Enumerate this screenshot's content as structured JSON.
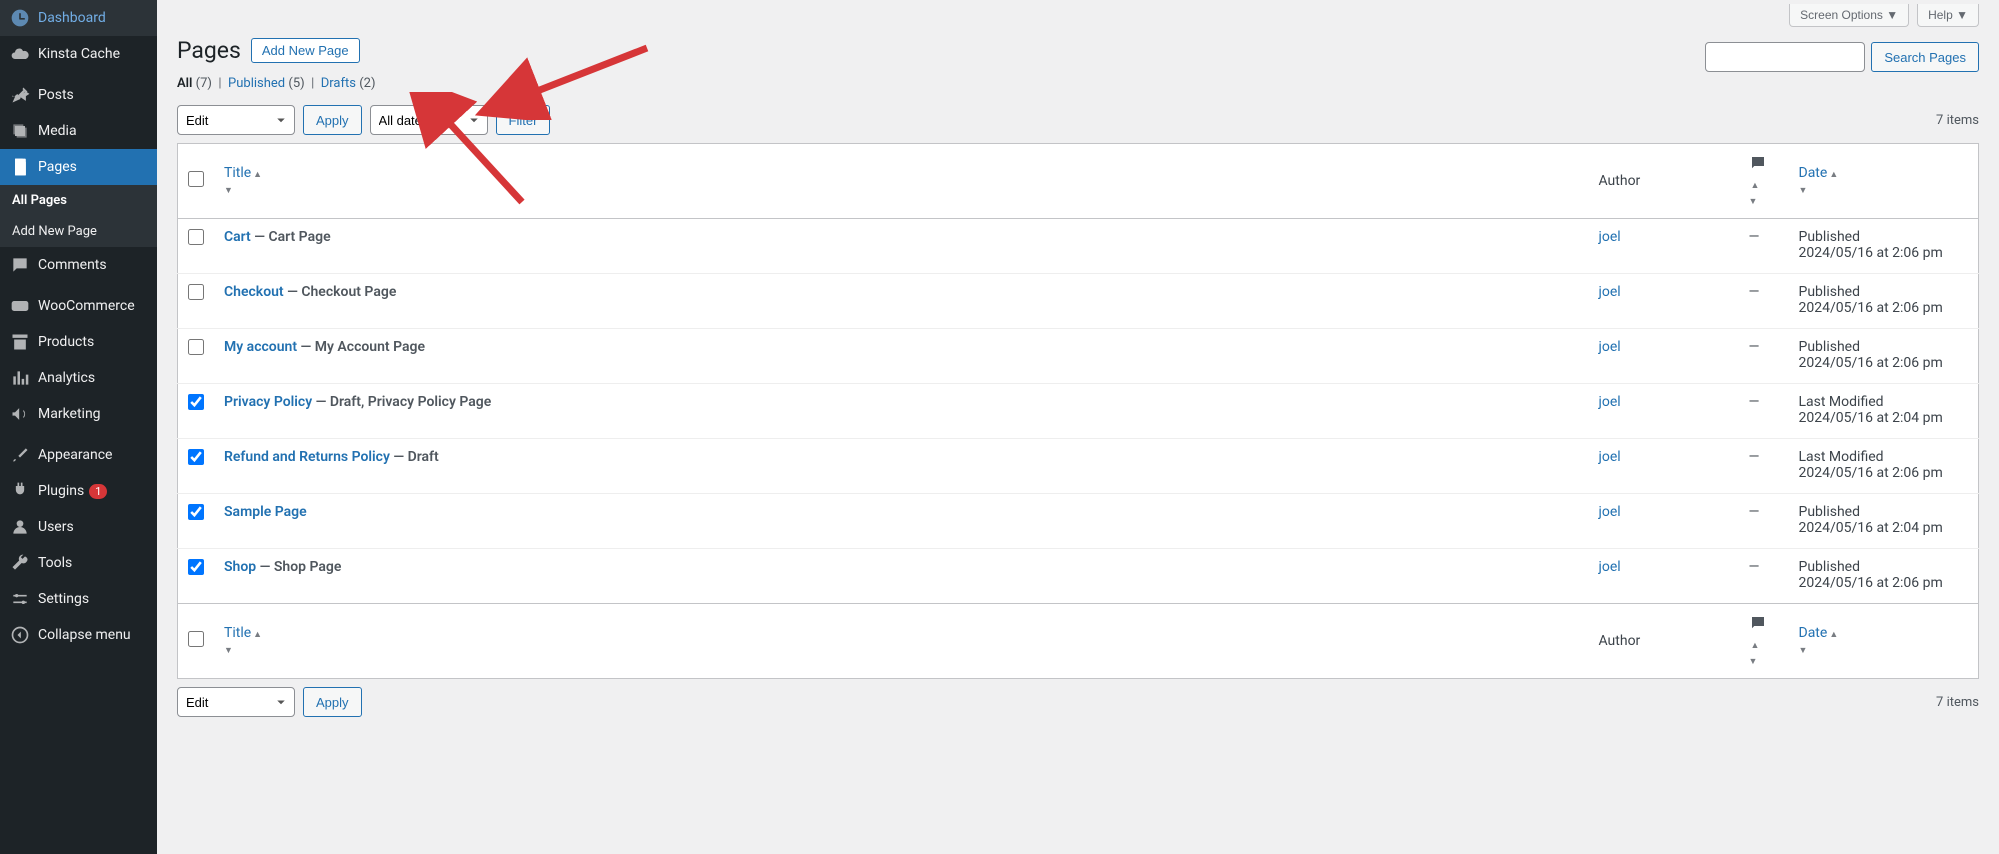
{
  "sidebar": {
    "items": [
      {
        "label": "Dashboard",
        "icon": "dashboard"
      },
      {
        "label": "Kinsta Cache",
        "icon": "cloud"
      },
      {
        "label": "Posts",
        "icon": "pin"
      },
      {
        "label": "Media",
        "icon": "media"
      },
      {
        "label": "Pages",
        "icon": "page",
        "active": true
      },
      {
        "label": "Comments",
        "icon": "comment"
      },
      {
        "label": "WooCommerce",
        "icon": "woo"
      },
      {
        "label": "Products",
        "icon": "archive"
      },
      {
        "label": "Analytics",
        "icon": "chart"
      },
      {
        "label": "Marketing",
        "icon": "megaphone"
      },
      {
        "label": "Appearance",
        "icon": "brush"
      },
      {
        "label": "Plugins",
        "icon": "plug",
        "badge": "1"
      },
      {
        "label": "Users",
        "icon": "user"
      },
      {
        "label": "Tools",
        "icon": "wrench"
      },
      {
        "label": "Settings",
        "icon": "settings"
      },
      {
        "label": "Collapse menu",
        "icon": "collapse"
      }
    ],
    "submenu": [
      {
        "label": "All Pages",
        "current": true
      },
      {
        "label": "Add New Page"
      }
    ]
  },
  "topTabs": {
    "screenOptions": "Screen Options",
    "help": "Help"
  },
  "header": {
    "title": "Pages",
    "addNew": "Add New Page"
  },
  "subsub": {
    "all": "All",
    "allCount": "(7)",
    "pub": "Published",
    "pubCount": "(5)",
    "draft": "Drafts",
    "draftCount": "(2)"
  },
  "bulk": {
    "edit": "Edit",
    "apply": "Apply"
  },
  "dateFilter": {
    "all": "All dates",
    "filter": "Filter"
  },
  "search": {
    "button": "Search Pages"
  },
  "itemsCount": "7 items",
  "columns": {
    "title": "Title",
    "author": "Author",
    "date": "Date"
  },
  "rows": [
    {
      "checked": false,
      "title": "Cart",
      "suffix": " — Cart Page",
      "author": "joel",
      "comments": "—",
      "status": "Published",
      "stamp": "2024/05/16 at 2:06 pm"
    },
    {
      "checked": false,
      "title": "Checkout",
      "suffix": " — Checkout Page",
      "author": "joel",
      "comments": "—",
      "status": "Published",
      "stamp": "2024/05/16 at 2:06 pm"
    },
    {
      "checked": false,
      "title": "My account",
      "suffix": " — My Account Page",
      "author": "joel",
      "comments": "—",
      "status": "Published",
      "stamp": "2024/05/16 at 2:06 pm"
    },
    {
      "checked": true,
      "title": "Privacy Policy",
      "suffix": " — Draft, Privacy Policy Page",
      "author": "joel",
      "comments": "—",
      "status": "Last Modified",
      "stamp": "2024/05/16 at 2:04 pm"
    },
    {
      "checked": true,
      "title": "Refund and Returns Policy",
      "suffix": " — Draft",
      "author": "joel",
      "comments": "—",
      "status": "Last Modified",
      "stamp": "2024/05/16 at 2:06 pm"
    },
    {
      "checked": true,
      "title": "Sample Page",
      "suffix": "",
      "author": "joel",
      "comments": "—",
      "status": "Published",
      "stamp": "2024/05/16 at 2:04 pm"
    },
    {
      "checked": true,
      "title": "Shop",
      "suffix": " — Shop Page",
      "author": "joel",
      "comments": "—",
      "status": "Published",
      "stamp": "2024/05/16 at 2:06 pm"
    }
  ]
}
